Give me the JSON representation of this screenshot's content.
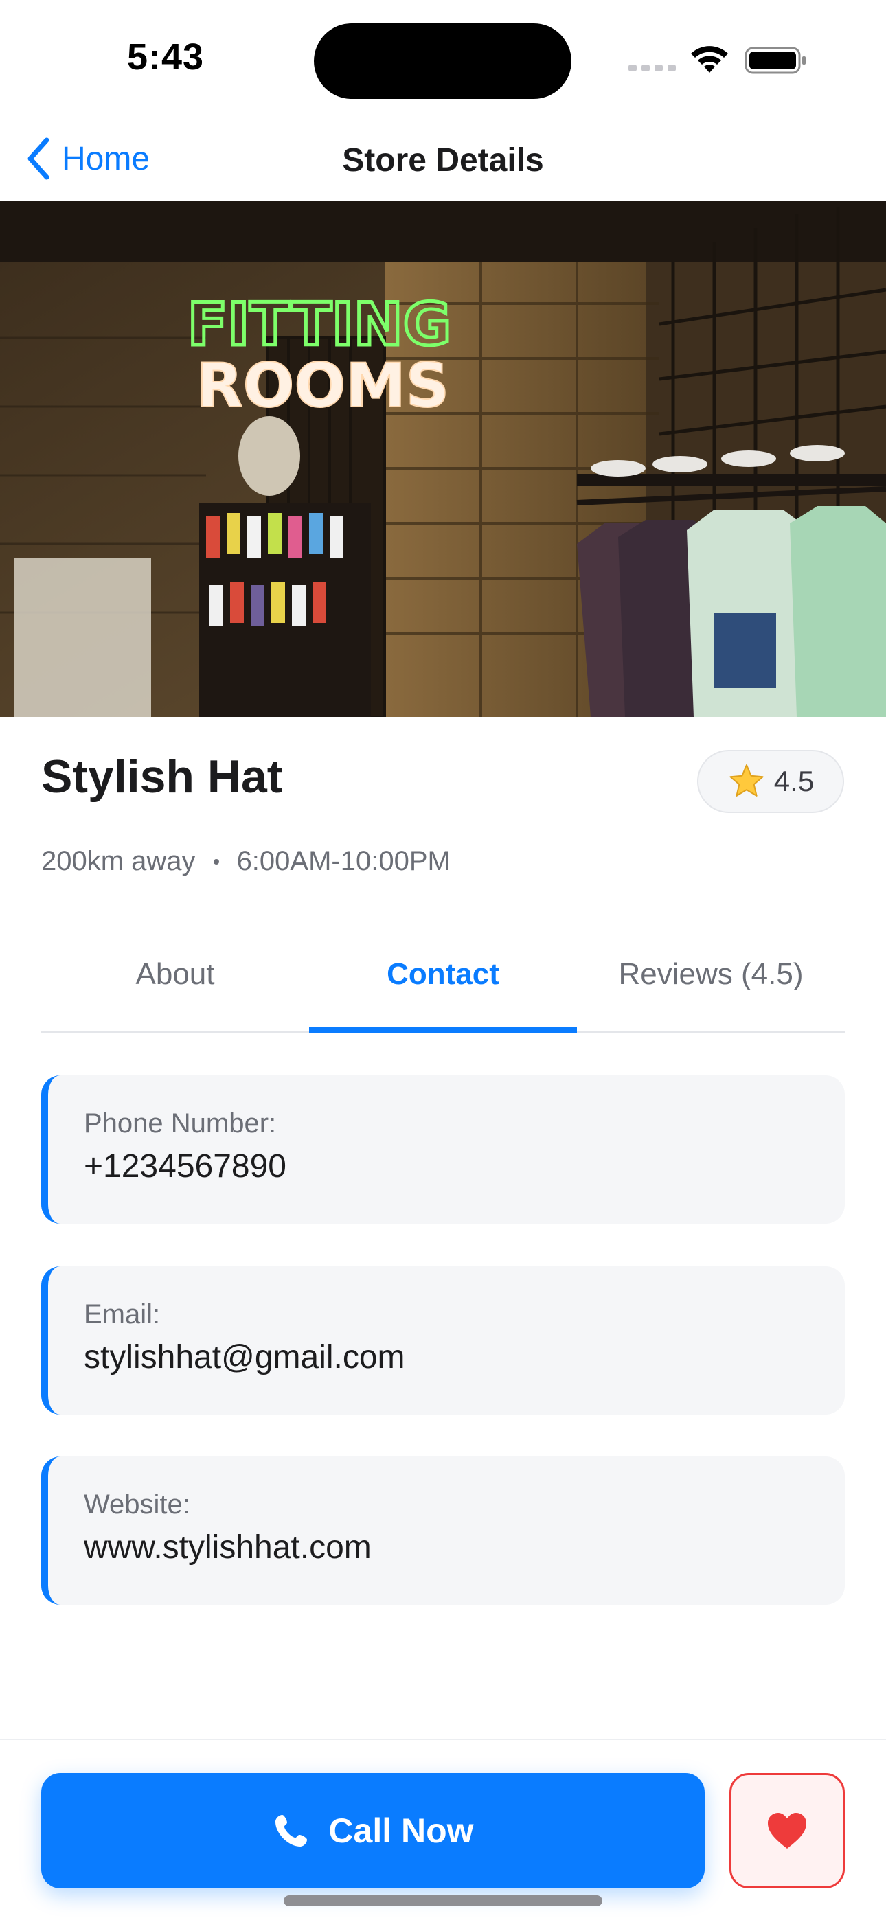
{
  "status_bar": {
    "time": "5:43"
  },
  "nav": {
    "back_label": "Home",
    "title": "Store Details"
  },
  "hero": {
    "sign_line1": "FITTING",
    "sign_line2": "ROOMS"
  },
  "store": {
    "name": "Stylish Hat",
    "rating": "4.5",
    "distance": "200km away",
    "hours": "6:00AM-10:00PM"
  },
  "tabs": [
    {
      "label": "About",
      "active": false
    },
    {
      "label": "Contact",
      "active": true
    },
    {
      "label": "Reviews (4.5)",
      "active": false
    }
  ],
  "contact": [
    {
      "label": "Phone Number:",
      "value": "+1234567890"
    },
    {
      "label": "Email:",
      "value": "stylishhat@gmail.com"
    },
    {
      "label": "Website:",
      "value": "www.stylishhat.com"
    }
  ],
  "actions": {
    "call_label": "Call Now"
  },
  "icons": {
    "back": "chevron-left-icon",
    "star": "star-icon",
    "phone": "phone-icon",
    "heart": "heart-icon",
    "wifi": "wifi-icon",
    "battery": "battery-icon"
  },
  "colors": {
    "accent": "#0a7cff",
    "favorite": "#ee3b3b",
    "card_bg": "#f5f6f8",
    "muted_text": "#6b6e76"
  }
}
